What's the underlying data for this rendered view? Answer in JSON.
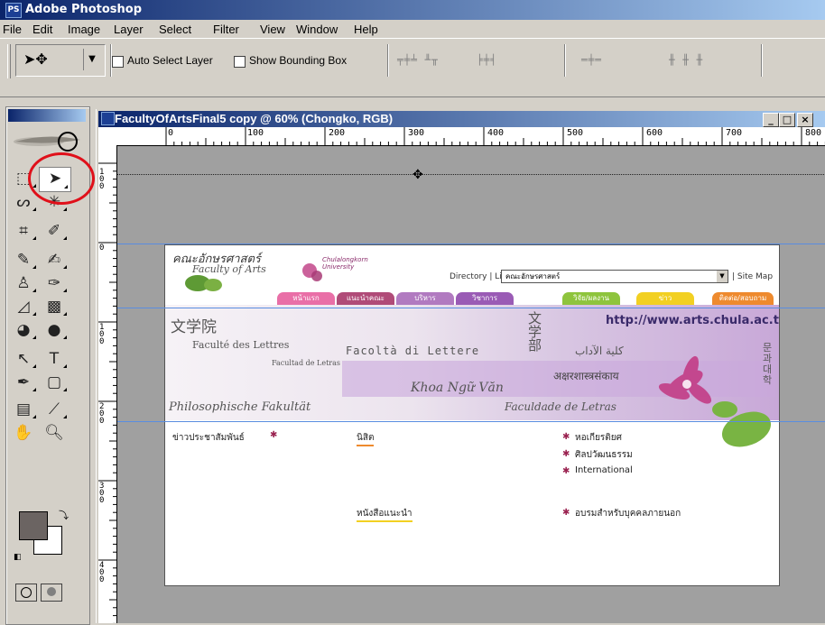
{
  "app": {
    "title": "Adobe Photoshop",
    "icon": "photoshop-app-icon"
  },
  "menu": [
    "File",
    "Edit",
    "Image",
    "Layer",
    "Select",
    "Filter",
    "View",
    "Window",
    "Help"
  ],
  "options": {
    "auto_select_label": "Auto Select Layer",
    "show_bbox_label": "Show Bounding Box",
    "auto_select_checked": false,
    "show_bbox_checked": false
  },
  "document": {
    "title": "FacultyOfArtsFinal5 copy @ 60% (Chongko, RGB)",
    "min_label": "_",
    "max_label": "□",
    "close_label": "×"
  },
  "rulers": {
    "h_labels": [
      "0",
      "100",
      "200",
      "300",
      "400",
      "500",
      "600",
      "700",
      "800"
    ],
    "v_labels": [
      "1 0 0",
      "0",
      "1 0 0",
      "2 0 0",
      "3 0 0",
      "4 0 0"
    ]
  },
  "webpage": {
    "logo_thai": "คณะอักษรศาสตร์",
    "logo_en": "Faculty of Arts",
    "univ": "Chulalongkorn University",
    "directory": "Directory | Links",
    "dropdown_value": "คณะอักษรศาสตร์",
    "site_map": "| Site Map",
    "tabs": [
      "หน้าแรก",
      "แนะนำคณะ",
      "บริหาร",
      "วิชาการ",
      "วิจัย/ผลงาน",
      "ข่าว",
      "ติดต่อ/สอบถาม"
    ],
    "url": "http://www.arts.chula.ac.th",
    "banner": {
      "chinese": "文学院",
      "japanese": "文学部",
      "french": "Faculté des Lettres",
      "italian": "Facoltà di Lettere",
      "latin_small": "Facultad de Letras",
      "arabic": "كلية الآداب",
      "hindi": "अक्षरशास्त्रसंकाय",
      "vietnamese": "Khoa Ngữ Văn",
      "german": "Philosophische Fakultät",
      "portuguese": "Faculdade de Letras",
      "korean": "문과대학"
    },
    "news": {
      "pr": "ข่าวประชาสัมพันธ์",
      "nisit": "นิสิต",
      "books": "หนังสือแนะนำ",
      "links": [
        "หอเกียรติยศ",
        "ศิลปวัฒนธรรม",
        "International",
        "อบรมสำหรับบุคคลภายนอก"
      ]
    }
  },
  "colors": {
    "title_start": "#0a246a",
    "title_end": "#a6caf0",
    "chrome": "#d4d0c8",
    "foreground": "#6b6462",
    "background": "#ffffff",
    "highlight": "#e0101a",
    "tab_colors": [
      "#e96fa7",
      "#b04b78",
      "#b17ac0",
      "#9a5bb5",
      "#8ec43d",
      "#f2d022",
      "#ee8a2e"
    ]
  }
}
